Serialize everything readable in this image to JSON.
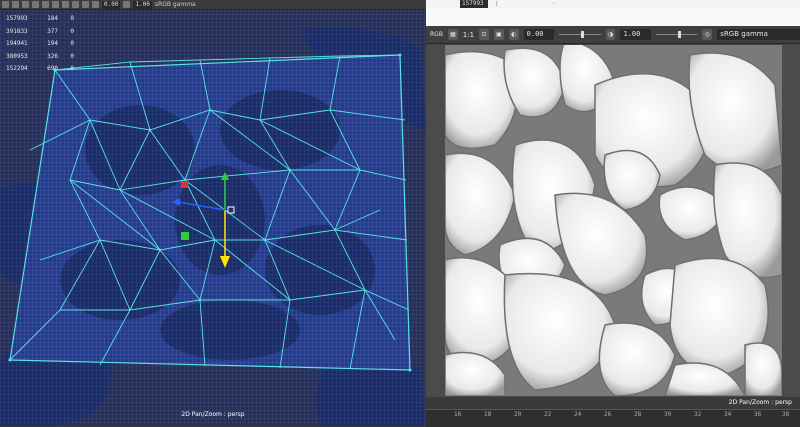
{
  "left_view": {
    "toolbar": {
      "field_1": "0.00",
      "field_2": "1.00",
      "color_space": "sRGB gamma"
    },
    "stats": [
      {
        "label": "",
        "v1": "157993",
        "v2": "184",
        "v3": "0"
      },
      {
        "label": "",
        "v1": "391833",
        "v2": "377",
        "v3": "0"
      },
      {
        "label": "",
        "v1": "194941",
        "v2": "194",
        "v3": "0"
      },
      {
        "label": "",
        "v1": "380953",
        "v2": "326",
        "v3": "0"
      },
      {
        "label": "",
        "v1": "152294",
        "v2": "690",
        "v3": "0"
      }
    ],
    "status": "2D Pan/Zoom : persp"
  },
  "right_view": {
    "top_field": "157993",
    "toolbar": {
      "rgb_label": "RGB",
      "ratio_label": "1:1",
      "exposure_value": "0.00",
      "gamma_value": "1.00",
      "color_space": "sRGB gamma"
    },
    "status": "2D Pan/Zoom : persp",
    "timeline_ticks": [
      "16",
      "18",
      "20",
      "22",
      "24",
      "26",
      "28",
      "30",
      "32",
      "34",
      "36",
      "38"
    ]
  },
  "colors": {
    "wire_blue": "#1d2a55",
    "uv_cyan": "#57e3e6",
    "toolbar_bg": "#3f3f3f"
  }
}
